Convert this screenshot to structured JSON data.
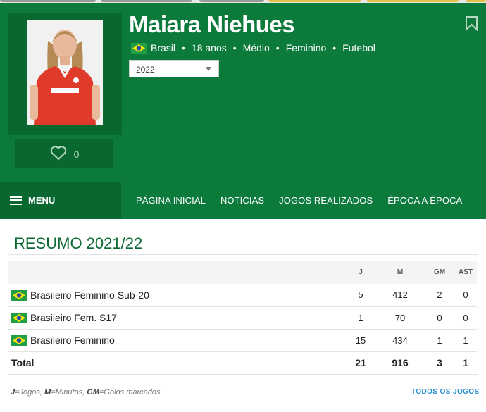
{
  "player": {
    "name": "Maiara Niehues",
    "country": "Brasil",
    "age": "18 anos",
    "position": "Médio",
    "gender": "Feminino",
    "sport": "Futebol",
    "likes": "0",
    "season_selected": "2022"
  },
  "nav": {
    "menu_label": "MENU",
    "items": [
      "PÁGINA INICIAL",
      "NOTÍCIAS",
      "JOGOS REALIZADOS",
      "ÉPOCA A ÉPOCA"
    ]
  },
  "summary": {
    "title": "RESUMO 2021/22",
    "columns": [
      "J",
      "M",
      "GM",
      "AST"
    ],
    "rows": [
      {
        "competition": "Brasileiro Feminino Sub-20",
        "j": "5",
        "m": "412",
        "gm": "2",
        "ast": "0"
      },
      {
        "competition": "Brasileiro Fem. S17",
        "j": "1",
        "m": "70",
        "gm": "0",
        "ast": "0"
      },
      {
        "competition": "Brasileiro Feminino",
        "j": "15",
        "m": "434",
        "gm": "1",
        "ast": "1"
      }
    ],
    "total": {
      "label": "Total",
      "j": "21",
      "m": "916",
      "gm": "3",
      "ast": "1"
    },
    "legend": {
      "j_key": "J",
      "j_text": "=Jogos, ",
      "m_key": "M",
      "m_text": "=Minutos, ",
      "gm_key": "GM",
      "gm_text": "=Golos marcados"
    },
    "all_games_link": "TODOS OS JOGOS"
  },
  "icons": {
    "bookmark": "bookmark-icon",
    "heart": "heart-icon",
    "menu": "hamburger-icon",
    "flag": "brazil-flag-icon"
  },
  "colors": {
    "brand_green": "#0b7a3b",
    "dark_green": "#086830",
    "title_green": "#0b6a33",
    "link_blue": "#2a8fd0"
  }
}
